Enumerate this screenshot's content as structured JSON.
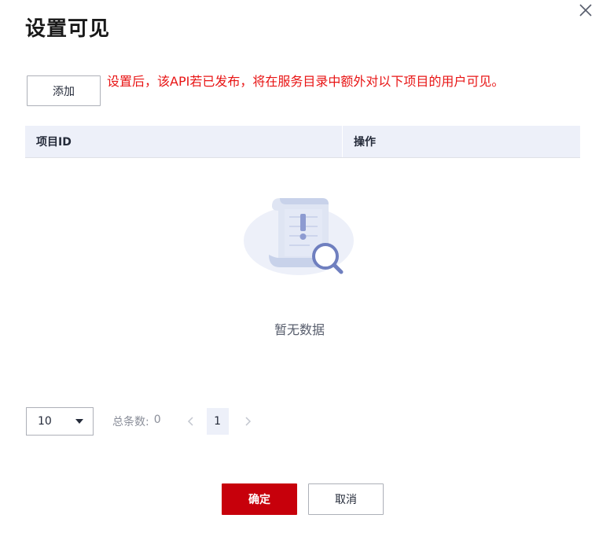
{
  "dialog": {
    "title": "设置可见",
    "close_icon": "close-icon",
    "add_button_label": "添加",
    "warning_text": "设置后，该API若已发布，将在服务目录中额外对以下项目的用户可见。"
  },
  "table": {
    "columns": [
      "项目ID",
      "操作"
    ],
    "rows": [],
    "empty_icon": "empty-document-search-icon",
    "empty_text": "暂无数据"
  },
  "pagination": {
    "page_size": "10",
    "total_label": "总条数:",
    "total_value": "0",
    "current_page": "1",
    "prev_icon": "chevron-left-icon",
    "next_icon": "chevron-right-icon"
  },
  "footer": {
    "confirm_label": "确定",
    "cancel_label": "取消"
  },
  "colors": {
    "warning": "#e81414",
    "primary": "#c7000b",
    "header_bg": "#edf0f9"
  }
}
